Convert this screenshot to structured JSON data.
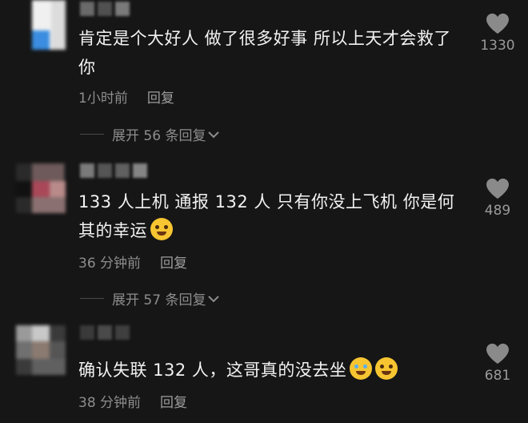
{
  "comments": [
    {
      "text": "肯定是个大好人 做了很多好事 所以上天才会救了你",
      "time": "1小时前",
      "reply_label": "回复",
      "like_count": "1330",
      "expand_label": "展开 56 条回复",
      "emojis": []
    },
    {
      "text": "133 人上机  通报 132 人  只有你没上飞机  你是何其的幸运",
      "time": "36 分钟前",
      "reply_label": "回复",
      "like_count": "489",
      "expand_label": "展开 57 条回复",
      "emojis": [
        "pleading-face"
      ]
    },
    {
      "text": "确认失联 132 人，这哥真的没去坐",
      "time": "38 分钟前",
      "reply_label": "回复",
      "like_count": "681",
      "expand_label": "",
      "emojis": [
        "tears-of-joy",
        "grinning-sweat"
      ]
    }
  ],
  "icons": {
    "like": "heart-icon",
    "expand": "chevron-down-icon"
  },
  "colors": {
    "background": "#161616",
    "text": "#f2f2f2",
    "meta": "#8d8d8d"
  }
}
